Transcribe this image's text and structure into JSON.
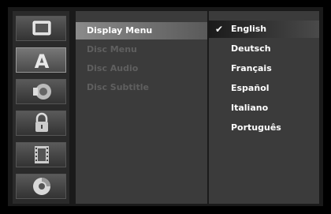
{
  "icons": [
    {
      "name": "display-tv-icon",
      "active": false
    },
    {
      "name": "language-a-icon",
      "active": true
    },
    {
      "name": "audio-speaker-icon",
      "active": false
    },
    {
      "name": "lock-icon",
      "active": false
    },
    {
      "name": "film-icon",
      "active": false
    },
    {
      "name": "disc-icon",
      "active": false
    }
  ],
  "menu": {
    "items": [
      {
        "label": "Display Menu",
        "selected": true
      },
      {
        "label": "Disc Menu",
        "selected": false
      },
      {
        "label": "Disc Audio",
        "selected": false
      },
      {
        "label": "Disc Subtitle",
        "selected": false
      }
    ]
  },
  "options": {
    "checkmark": "✔",
    "items": [
      {
        "label": "English",
        "selected": true
      },
      {
        "label": "Deutsch",
        "selected": false
      },
      {
        "label": "Français",
        "selected": false
      },
      {
        "label": "Español",
        "selected": false
      },
      {
        "label": "Italiano",
        "selected": false
      },
      {
        "label": "Português",
        "selected": false
      }
    ]
  }
}
